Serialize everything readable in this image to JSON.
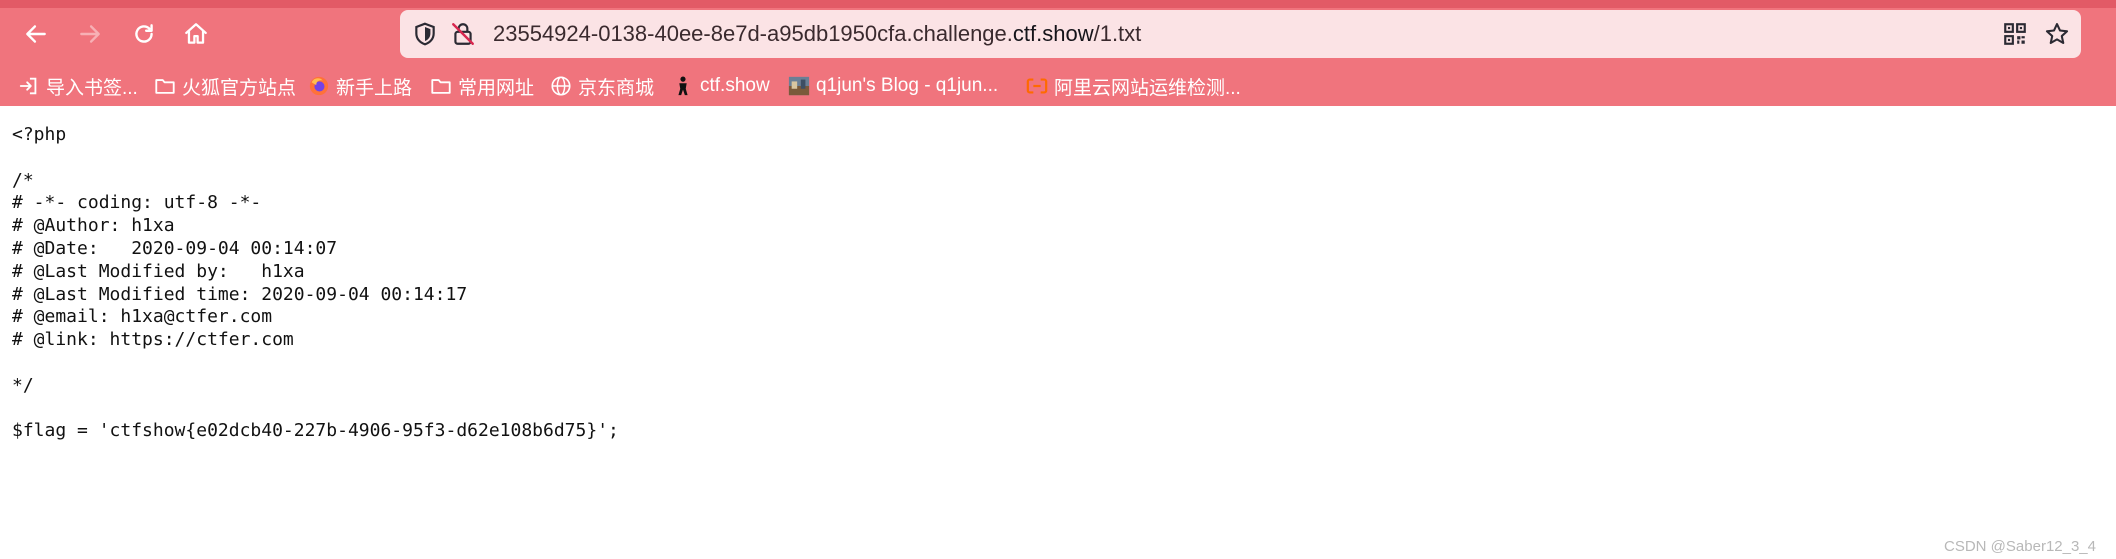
{
  "toolbar": {
    "back_icon": "arrow-left-icon",
    "forward_icon": "arrow-right-icon",
    "reload_icon": "reload-icon",
    "home_icon": "home-icon",
    "url_prefix": "23554924-0138-40ee-8e7d-a95db1950cfa.challenge.",
    "url_host": "ctf.show",
    "url_path": "/1.txt",
    "accent_color": "#f0747d"
  },
  "bookmarks": [
    {
      "icon": "import-icon",
      "label": "导入书签..."
    },
    {
      "icon": "folder-icon",
      "label": "火狐官方站点"
    },
    {
      "icon": "firefox-icon",
      "label": "新手上路"
    },
    {
      "icon": "folder-icon",
      "label": "常用网址"
    },
    {
      "icon": "globe-icon",
      "label": "京东商城"
    },
    {
      "icon": "ctfshow-icon",
      "label": "ctf.show"
    },
    {
      "icon": "blog-favicon-icon",
      "label": "q1jun's Blog - q1jun..."
    },
    {
      "icon": "aliyun-icon",
      "label": "阿里云网站运维检测..."
    }
  ],
  "file": {
    "lines": [
      "<?php",
      "",
      "/*",
      "# -*- coding: utf-8 -*-",
      "# @Author: h1xa",
      "# @Date:   2020-09-04 00:14:07",
      "# @Last Modified by:   h1xa",
      "# @Last Modified time: 2020-09-04 00:14:17",
      "# @email: h1xa@ctfer.com",
      "# @link: https://ctfer.com",
      "",
      "*/",
      "",
      "$flag = 'ctfshow{e02dcb40-227b-4906-95f3-d62e108b6d75}';"
    ]
  },
  "watermark": "CSDN @Saber12_3_4"
}
